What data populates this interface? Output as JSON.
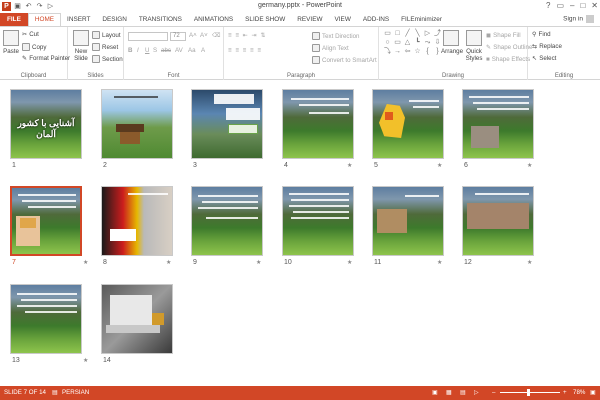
{
  "window": {
    "title": "germany.pptx - PowerPoint",
    "app_letter": "P",
    "help": "?",
    "controls": [
      "▭",
      "–",
      "□",
      "✕"
    ]
  },
  "tabs": [
    "FILE",
    "HOME",
    "INSERT",
    "DESIGN",
    "TRANSITIONS",
    "ANIMATIONS",
    "SLIDE SHOW",
    "REVIEW",
    "VIEW",
    "ADD-INS",
    "FILEminimizer"
  ],
  "active_tab": "HOME",
  "signin": "Sign in",
  "ribbon": {
    "clipboard": {
      "label": "Clipboard",
      "paste": "Paste",
      "cut": "Cut",
      "copy": "Copy",
      "format_painter": "Format Painter"
    },
    "slides": {
      "label": "Slides",
      "new_slide": "New Slide",
      "layout": "Layout",
      "reset": "Reset",
      "section": "Section"
    },
    "font": {
      "label": "Font",
      "font_size": "72",
      "buttons": [
        "B",
        "I",
        "U",
        "S",
        "abc",
        "AV",
        "Aa",
        "A"
      ]
    },
    "paragraph": {
      "label": "Paragraph",
      "text_direction": "Text Direction",
      "align_text": "Align Text",
      "convert_smartart": "Convert to SmartArt"
    },
    "drawing": {
      "label": "Drawing",
      "arrange": "Arrange",
      "quick_styles": "Quick Styles",
      "shape_fill": "Shape Fill",
      "shape_outline": "Shape Outline",
      "shape_effects": "Shape Effects",
      "shapes": [
        "▭",
        "□",
        "╱",
        "╲",
        "▷",
        "⤴",
        "○",
        "▭",
        "△",
        "┗",
        "⤳",
        "⇩",
        "⤵",
        "→",
        "⇦",
        "☆",
        "{",
        "}"
      ]
    },
    "editing": {
      "label": "Editing",
      "find": "Find",
      "replace": "Replace",
      "select": "Select"
    }
  },
  "slides": [
    {
      "num": "1",
      "title": "آشنایی با کشور آلمان"
    },
    {
      "num": "2"
    },
    {
      "num": "3"
    },
    {
      "num": "4"
    },
    {
      "num": "5"
    },
    {
      "num": "6"
    },
    {
      "num": "7"
    },
    {
      "num": "8"
    },
    {
      "num": "9"
    },
    {
      "num": "10"
    },
    {
      "num": "11"
    },
    {
      "num": "12"
    },
    {
      "num": "13"
    },
    {
      "num": "14"
    }
  ],
  "selected_slide": "7",
  "transition_marker": "★",
  "status": {
    "slide_info": "SLIDE 7 OF 14",
    "language": "PERSIAN",
    "zoom": "78%",
    "zoom_minus": "–",
    "zoom_plus": "+"
  },
  "colors": {
    "accent": "#d24726",
    "ribbon_border": "#d4d4d4"
  }
}
